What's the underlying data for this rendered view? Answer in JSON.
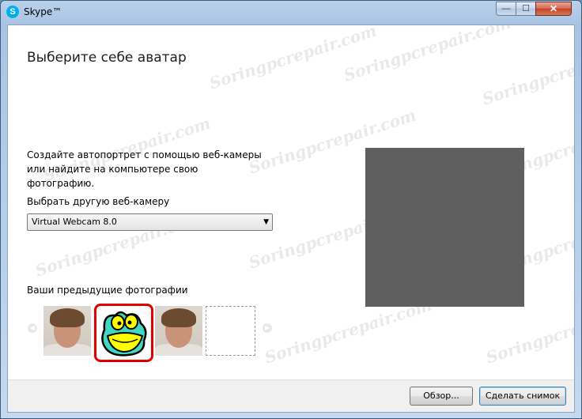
{
  "window": {
    "title": "Skype™"
  },
  "window_controls": {
    "minimize": "—",
    "maximize": "☐",
    "close": "✕"
  },
  "content": {
    "heading": "Выберите себе аватар",
    "description": "Создайте автопортрет с помощью веб-камеры или найдите на компьютере свою фотографию.",
    "camera_label": "Выбрать другую веб-камеру",
    "camera_select": {
      "value": "Virtual Webcam 8.0"
    },
    "previous_photos_label": "Ваши предыдущие фотографии",
    "thumbnails": [
      {
        "kind": "photo"
      },
      {
        "kind": "cartoon-frog",
        "selected": true
      },
      {
        "kind": "photo"
      },
      {
        "kind": "empty"
      }
    ]
  },
  "footer": {
    "browse_button": "Обзор...",
    "snapshot_button": "Сделать снимок"
  },
  "watermark": "Soringpcrepair.com",
  "colors": {
    "accent_skype": "#00aff0",
    "selection_border": "#e10000",
    "preview_bg": "#5f5f5f"
  }
}
